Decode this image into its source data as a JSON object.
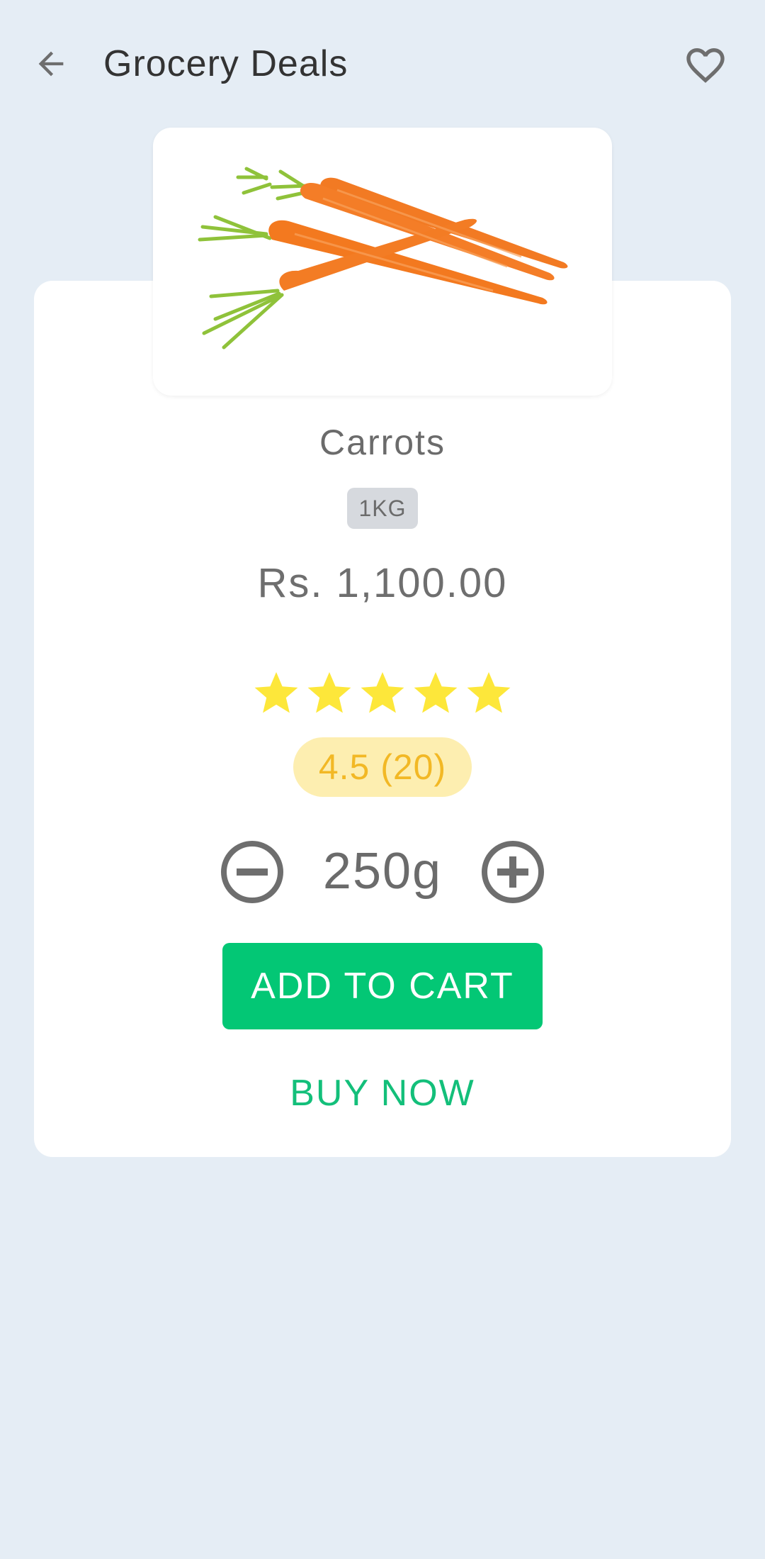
{
  "header": {
    "title": "Grocery Deals",
    "back_icon": "arrow-left-icon",
    "favorite_icon": "heart-outline-icon"
  },
  "product": {
    "name": "Carrots",
    "unit_badge": "1KG",
    "price": "Rs. 1,100.00",
    "rating_stars": 5,
    "rating_text": "4.5 (20)",
    "quantity": "250g",
    "image_alt": "carrots"
  },
  "actions": {
    "add_to_cart": "ADD TO CART",
    "buy_now": "BUY NOW"
  },
  "colors": {
    "background": "#e5edf5",
    "card": "#ffffff",
    "accent_green": "#03c775",
    "buy_now_text": "#13bf7a",
    "star": "#fde73a",
    "rating_pill_bg": "#fdeeb0",
    "rating_text": "#f2b825"
  }
}
